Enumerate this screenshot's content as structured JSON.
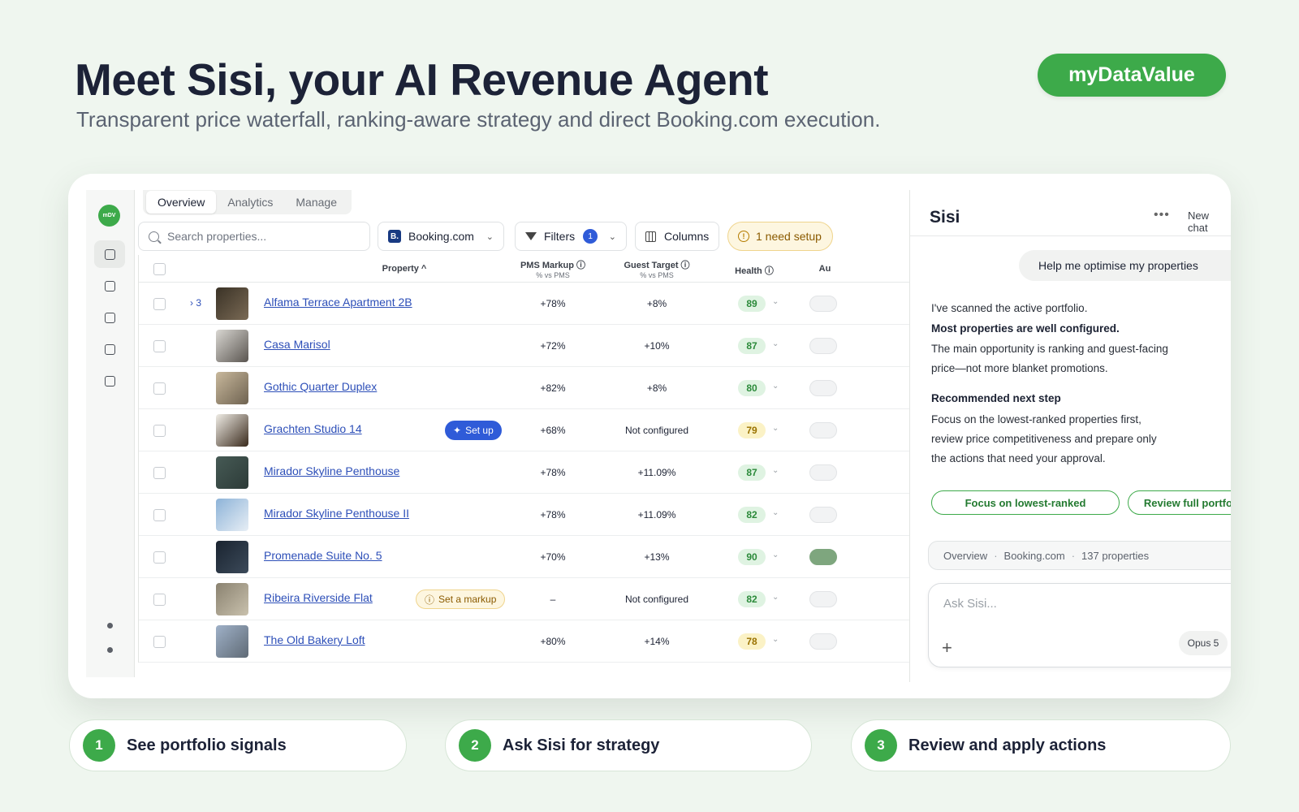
{
  "hero": {
    "title": "Meet Sisi, your AI Revenue Agent",
    "subtitle": "Transparent price waterfall, ranking-aware strategy and direct Booking.com execution.",
    "brand": "myDataValue"
  },
  "rail": {
    "logo": "mDV"
  },
  "tabs": [
    "Overview",
    "Analytics",
    "Manage"
  ],
  "toolbar": {
    "search_placeholder": "Search properties...",
    "channel_letter": "B.",
    "channel": "Booking.com",
    "filters_label": "Filters",
    "filters_count": "1",
    "columns_label": "Columns",
    "setup_label": "1 need setup"
  },
  "table": {
    "headers": {
      "property": "Property ^",
      "pms": "PMS Markup ⓘ",
      "pms_sub": "% vs PMS",
      "guest": "Guest Target ⓘ",
      "guest_sub": "% vs PMS",
      "health": "Health ⓘ",
      "auto": "Au"
    },
    "rows": [
      {
        "name": "Alfama Terrace Apartment 2B",
        "expander": "› 3",
        "action": "",
        "pms": "+78%",
        "guest": "+8%",
        "health": "89",
        "level": "g",
        "auto": false
      },
      {
        "name": "Casa Marisol",
        "expander": "",
        "action": "",
        "pms": "+72%",
        "guest": "+10%",
        "health": "87",
        "level": "g",
        "auto": false
      },
      {
        "name": "Gothic Quarter Duplex",
        "expander": "",
        "action": "",
        "pms": "+82%",
        "guest": "+8%",
        "health": "80",
        "level": "g",
        "auto": false
      },
      {
        "name": "Grachten Studio 14",
        "expander": "",
        "action": "Set up",
        "pms": "+68%",
        "guest": "Not configured",
        "health": "79",
        "level": "y",
        "auto": false
      },
      {
        "name": "Mirador Skyline Penthouse",
        "expander": "",
        "action": "",
        "pms": "+78%",
        "guest": "+11.09%",
        "health": "87",
        "level": "g",
        "auto": false
      },
      {
        "name": "Mirador Skyline Penthouse II",
        "expander": "",
        "action": "",
        "pms": "+78%",
        "guest": "+11.09%",
        "health": "82",
        "level": "g",
        "auto": false
      },
      {
        "name": "Promenade Suite No. 5",
        "expander": "",
        "action": "",
        "pms": "+70%",
        "guest": "+13%",
        "health": "90",
        "level": "g",
        "auto": true
      },
      {
        "name": "Ribeira Riverside Flat",
        "expander": "",
        "action": "Set a markup",
        "pms": "–",
        "guest": "Not configured",
        "health": "82",
        "level": "g",
        "auto": false
      },
      {
        "name": "The Old Bakery Loft",
        "expander": "",
        "action": "",
        "pms": "+80%",
        "guest": "+14%",
        "health": "78",
        "level": "y",
        "auto": false
      }
    ]
  },
  "chat": {
    "title": "Sisi",
    "dots": "•••",
    "new_chat": "New chat",
    "close": "✕",
    "user_message": "Help me optimise my properties",
    "p1": "I've scanned the active portfolio.",
    "p2": "Most properties are well configured.",
    "p3a": "The main opportunity is ranking and guest-facing",
    "p3b": "price—not more blanket promotions.",
    "p4": "Recommended next step",
    "p5a": "Focus on the lowest-ranked properties first,",
    "p5b": "review price competitiveness and prepare only",
    "p5c": "the actions that need your approval.",
    "chip1": "Focus on lowest-ranked",
    "chip2": "Review full portfolio",
    "ctx1": "Overview",
    "ctx2": "Booking.com",
    "ctx3": "137 properties",
    "sep": "·",
    "placeholder": "Ask Sisi...",
    "plus": "+",
    "model": "Opus 5",
    "send": "↑"
  },
  "steps": [
    {
      "num": "1",
      "label": "See portfolio signals"
    },
    {
      "num": "2",
      "label": "Ask Sisi for strategy"
    },
    {
      "num": "3",
      "label": "Review and apply actions"
    }
  ],
  "colors": {
    "brand_green": "#3daa4a",
    "accent_blue": "#2f5bd8",
    "link_blue": "#2d4fb8",
    "warning_amber": "#8a5a00"
  }
}
